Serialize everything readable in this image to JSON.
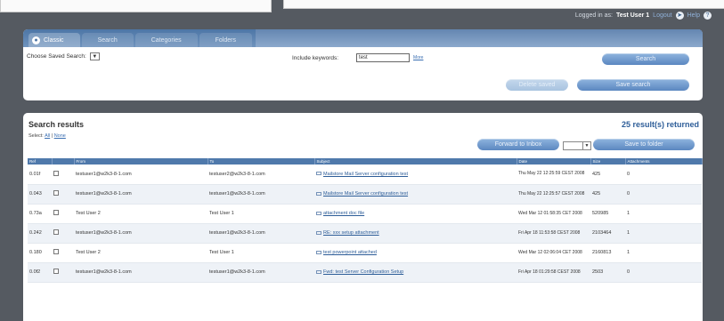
{
  "userbar": {
    "prefix": "Logged in as:",
    "username": "Test User 1",
    "logout": "Logout",
    "help": "Help",
    "logout_icon": "logout-icon",
    "help_icon": "help-icon"
  },
  "search_tabs": [
    {
      "label": "Classic",
      "active": true
    },
    {
      "label": "Search",
      "active": false
    },
    {
      "label": "Categories",
      "active": false
    },
    {
      "label": "Folders",
      "active": false
    }
  ],
  "search_form": {
    "saved_search_label": "Choose Saved Search:",
    "keyword_label": "Include keywords:",
    "keyword_value": "test",
    "keyword_link": "More",
    "search_button": "Search",
    "delete_saved_button": "Delete saved",
    "save_search_button": "Save search"
  },
  "results": {
    "title": "Search results",
    "count": "25 result(s) returned",
    "select_label": "Select:",
    "select_all": "All",
    "select_none": "None",
    "forward_button": "Forward to Inbox",
    "save_folder_button": "Save to folder",
    "columns": [
      "Ref",
      "",
      "From",
      "To",
      "Subject",
      "Date",
      "Size",
      "Attachments"
    ],
    "rows": [
      {
        "ref": "0.01f",
        "from": "testuser1@w2k3-8-1.com",
        "to": "testuser2@w2k3-8-1.com",
        "subject": "Mailstore Mail Server configuration test",
        "date": "Thu May 22 12:25:59 CEST 2008",
        "size": "425",
        "attachments": "0"
      },
      {
        "ref": "0.043",
        "from": "testuser1@w2k3-8-1.com",
        "to": "testuser1@w2k3-8-1.com",
        "subject": "Mailstore Mail Server configuration test",
        "date": "Thu May 22 12:25:57 CEST 2008",
        "size": "425",
        "attachments": "0"
      },
      {
        "ref": "0.73a",
        "from": "Test User 2",
        "to": "Test User 1",
        "subject": "attachment doc file",
        "date": "Wed Mar 12 01:58:35 CET 2008",
        "size": "520985",
        "attachments": "1"
      },
      {
        "ref": "0.242",
        "from": "testuser1@w2k3-8-1.com",
        "to": "testuser1@w2k3-8-1.com",
        "subject": "RE: xxx setup attachment",
        "date": "Fri Apr 18 11:53:58 CEST 2008",
        "size": "2103464",
        "attachments": "1"
      },
      {
        "ref": "0.180",
        "from": "Test User 2",
        "to": "Test User 1",
        "subject": "test powerpoint attached",
        "date": "Wed Mar 12 02:06:04 CET 2008",
        "size": "2160813",
        "attachments": "1"
      },
      {
        "ref": "0.0f2",
        "from": "testuser1@w2k3-8-1.com",
        "to": "testuser1@w2k3-8-1.com",
        "subject": "Fwd: test Server Configuration Setup",
        "date": "Fri Apr 18 01:29:58 CEST 2008",
        "size": "2503",
        "attachments": "0"
      }
    ]
  }
}
